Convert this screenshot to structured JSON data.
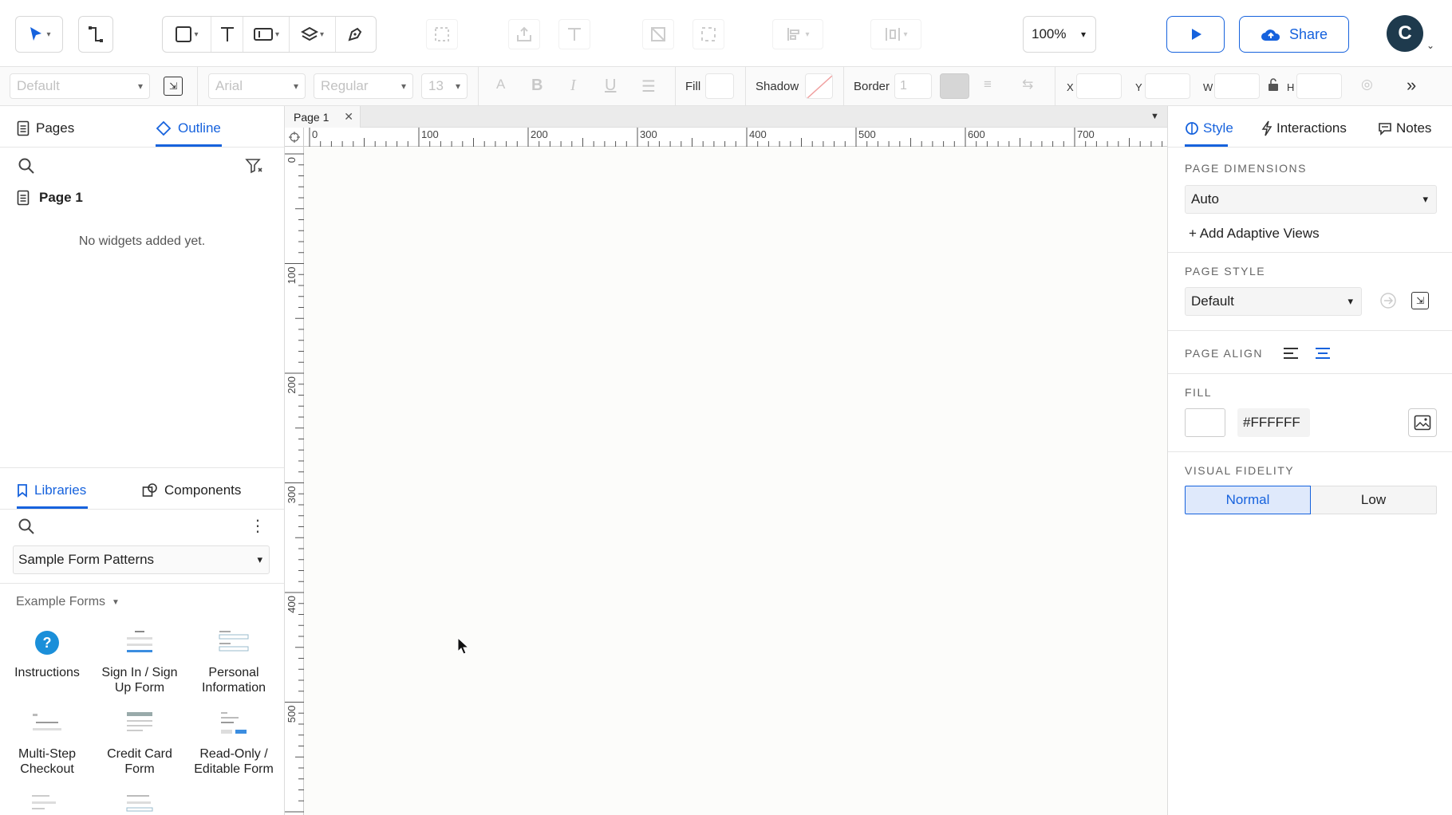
{
  "toolbar": {
    "zoom": "100%",
    "share_label": "Share",
    "avatar_initial": "C"
  },
  "format_bar": {
    "style_select": "Default",
    "font_select": "Arial",
    "weight_select": "Regular",
    "size_select": "13",
    "fill_label": "Fill",
    "shadow_label": "Shadow",
    "border_label": "Border",
    "border_value": "1",
    "x_label": "X",
    "y_label": "Y",
    "w_label": "W",
    "h_label": "H"
  },
  "left_panel": {
    "tabs": {
      "pages": "Pages",
      "outline": "Outline"
    },
    "page_item": "Page 1",
    "empty_text": "No widgets added yet.",
    "lib_tabs": {
      "libraries": "Libraries",
      "components": "Components"
    },
    "library_select": "Sample Form Patterns",
    "group_label": "Example Forms",
    "widgets": [
      {
        "line1": "Instructions",
        "line2": ""
      },
      {
        "line1": "Sign In / Sign",
        "line2": "Up Form"
      },
      {
        "line1": "Personal",
        "line2": "Information"
      },
      {
        "line1": "Multi-Step",
        "line2": "Checkout"
      },
      {
        "line1": "Credit Card",
        "line2": "Form"
      },
      {
        "line1": "Read-Only /",
        "line2": "Editable Form"
      }
    ]
  },
  "canvas": {
    "tab_label": "Page 1",
    "h_ticks": [
      "0",
      "100",
      "200",
      "300",
      "400",
      "500",
      "600",
      "700"
    ],
    "v_ticks": [
      "0",
      "100",
      "200",
      "300",
      "400",
      "500"
    ]
  },
  "right_panel": {
    "tabs": {
      "style": "Style",
      "interactions": "Interactions",
      "notes": "Notes"
    },
    "page_dimensions": {
      "heading": "PAGE DIMENSIONS",
      "value": "Auto"
    },
    "add_adaptive": "+ Add Adaptive Views",
    "page_style": {
      "heading": "PAGE STYLE",
      "value": "Default"
    },
    "page_align": {
      "heading": "PAGE ALIGN"
    },
    "fill": {
      "heading": "FILL",
      "hex": "#FFFFFF"
    },
    "visual_fidelity": {
      "heading": "VISUAL FIDELITY",
      "normal": "Normal",
      "low": "Low"
    }
  },
  "colors": {
    "accent": "#1662dd",
    "avatar": "#1e3a4d"
  }
}
